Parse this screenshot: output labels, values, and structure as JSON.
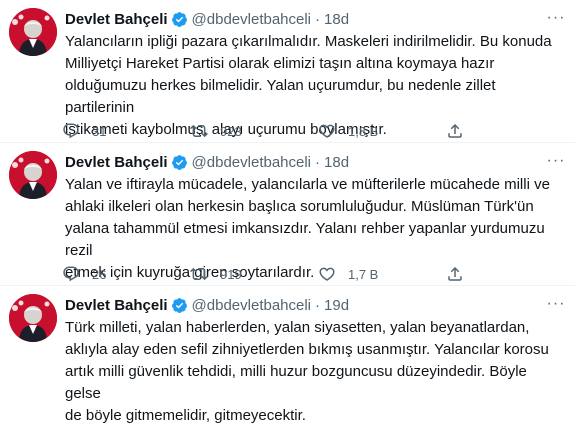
{
  "colors": {
    "text": "#0f1419",
    "secondary": "#536471",
    "verified": "#1d9bf0",
    "avatar_bg": "#c8102e"
  },
  "tweets": [
    {
      "name": "Devlet Bahçeli",
      "handle": "@dbdevletbahceli",
      "time": "18d",
      "text": "Yalancıların ipliği pazara çıkarılmalıdır. Maskeleri indirilmelidir. Bu konuda\nMilliyetçi Hareket Partisi olarak elimizi taşın altına koymaya hazır\nolduğumuzu herkes bilmelidir. Yalan uçurumdur, bu nedenle zillet partilerinin\nistikameti kaybolmuş, alayı uçurumu boylamıştır.",
      "replies": "31",
      "retweets": "923",
      "likes": "1,8 B"
    },
    {
      "name": "Devlet Bahçeli",
      "handle": "@dbdevletbahceli",
      "time": "18d",
      "text": "Yalan ve iftirayla mücadele, yalancılarla ve müfterilerle mücahede milli ve\nahlaki ilkeleri olan herkesin başlıca sorumluluğudur. Müslüman Türk'ün\nyalana tahammül etmesi imkansızdır. Yalanı rehber yapanlar yurdumuzu rezil\netmek için kuyruğa giren soytarılardır.",
      "replies": "26",
      "retweets": "919",
      "likes": "1,7 B"
    },
    {
      "name": "Devlet Bahçeli",
      "handle": "@dbdevletbahceli",
      "time": "19d",
      "text": "Türk milleti, yalan haberlerden, yalan siyasetten, yalan beyanatlardan,\naklıyla alay eden sefil zihniyetlerden bıkmış usanmıştır. Yalancılar korosu\nartık milli güvenlik tehdidi, milli huzur bozguncusu düzeyindedir. Böyle gelse\nde böyle gitmemelidir, gitmeyecektir.",
      "replies": "",
      "retweets": "",
      "likes": ""
    }
  ]
}
